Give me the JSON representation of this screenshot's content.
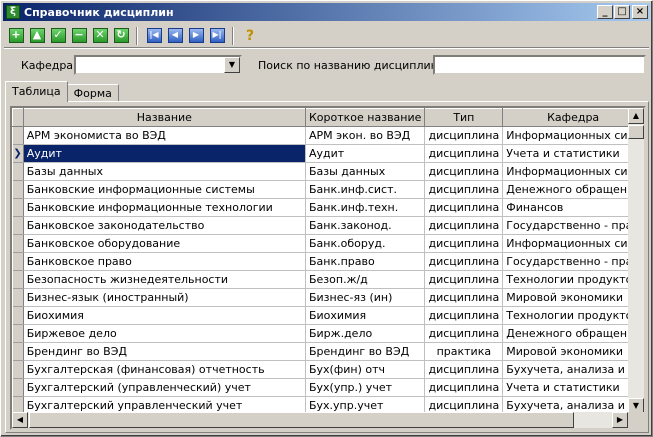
{
  "window": {
    "title": "Справочник дисциплин",
    "buttons": {
      "minimize": "_",
      "maximize": "□",
      "close": "×"
    }
  },
  "toolbar": {
    "buttons": [
      {
        "name": "add",
        "glyph": "+",
        "color": "green"
      },
      {
        "name": "move-up",
        "glyph": "▲",
        "color": "green"
      },
      {
        "name": "confirm",
        "glyph": "✓",
        "color": "green"
      },
      {
        "name": "remove",
        "glyph": "−",
        "color": "green"
      },
      {
        "name": "cancel",
        "glyph": "✕",
        "color": "green"
      },
      {
        "name": "refresh",
        "glyph": "↻",
        "color": "green"
      },
      {
        "name": "first",
        "glyph": "|◀",
        "color": "blue"
      },
      {
        "name": "prev",
        "glyph": "◀",
        "color": "blue"
      },
      {
        "name": "next",
        "glyph": "▶",
        "color": "blue"
      },
      {
        "name": "last",
        "glyph": "▶|",
        "color": "blue"
      }
    ],
    "help_glyph": "?"
  },
  "filter": {
    "department_label": "Кафедра:",
    "department_value": "",
    "search_label": "Поиск по названию дисциплины:",
    "search_value": ""
  },
  "tabs": [
    {
      "label": "Таблица",
      "active": true
    },
    {
      "label": "Форма",
      "active": false
    }
  ],
  "grid": {
    "columns": [
      "Название",
      "Короткое название",
      "Тип",
      "Кафедра"
    ],
    "current_row_marker": "❯",
    "rows": [
      [
        "АРМ экономиста во ВЭД",
        "АРМ экон. во ВЭД",
        "дисциплина",
        "Информационных сист"
      ],
      [
        "Аудит",
        "Аудит",
        "дисциплина",
        "Учета и статистики"
      ],
      [
        "Базы данных",
        "Базы данных",
        "дисциплина",
        "Информационных сист"
      ],
      [
        "Банковские информационные системы",
        "Банк.инф.сист.",
        "дисциплина",
        "Денежного обращени"
      ],
      [
        "Банковские информационные технологии",
        "Банк.инф.техн.",
        "дисциплина",
        "Финансов"
      ],
      [
        "Банковское законодательство",
        "Банк.законод.",
        "дисциплина",
        "Государственно - пра"
      ],
      [
        "Банковское оборудование",
        "Банк.оборуд.",
        "дисциплина",
        "Информационных сист"
      ],
      [
        "Банковское право",
        "Банк.право",
        "дисциплина",
        "Государственно - пра"
      ],
      [
        "Безопасность жизнедеятельности",
        "Безоп.ж/д",
        "дисциплина",
        "Технологии продукто"
      ],
      [
        "Бизнес-язык (иностранный)",
        "Бизнес-яз (ин)",
        "дисциплина",
        "Мировой экономики"
      ],
      [
        "Биохимия",
        "Биохимия",
        "дисциплина",
        "Технологии продукто"
      ],
      [
        "Биржевое дело",
        "Бирж.дело",
        "дисциплина",
        "Денежного обращени"
      ],
      [
        "Брендинг во ВЭД",
        "Брендинг во ВЭД",
        "практика",
        "Мировой экономики"
      ],
      [
        "Бухгалтерская (финансовая) отчетность",
        "Бух(фин) отч",
        "дисциплина",
        "Бухучета, анализа и а"
      ],
      [
        "Бухгалтерский (управленческий) учет",
        "Бух(упр.) учет",
        "дисциплина",
        "Учета и статистики"
      ],
      [
        "Бухгалтерский управленческий учет",
        "Бух.упр.учет",
        "дисциплина",
        "Бухучета, анализа и а"
      ]
    ],
    "selected_row": 1
  },
  "scrollbars": {
    "up": "▲",
    "down": "▼",
    "left": "◀",
    "right": "▶"
  }
}
